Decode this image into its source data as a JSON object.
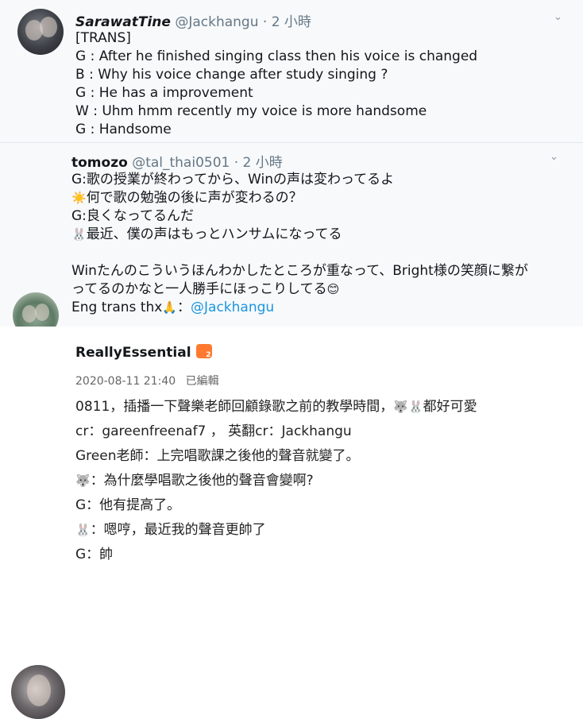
{
  "tweet1": {
    "name": "SarawatTine",
    "handle": "@Jackhangu",
    "time": "· 2 小時",
    "lines": [
      "[TRANS]",
      "G : After he finished singing class then his voice is changed",
      "B : Why his voice change after study singing ?",
      "G : He has a improvement",
      "W : Uhm hmm recently my voice is more handsome",
      "G : Handsome"
    ]
  },
  "tweet2": {
    "name": "tomozo",
    "handle": "@tal_thai0501",
    "time": "· 2 小時",
    "lines": [
      "G:歌の授業が終わってから、Winの声は変わってるよ",
      "何で歌の勉強の後に声が変わるの？",
      "G:良くなってるんだ",
      "最近、僕の声はもっとハンサムになってる",
      "Winたんのこういうほんわかしたところが重なって、Bright様の笑顔に繋が",
      "ってるのかなと一人勝手にほっこりしてる"
    ],
    "credit_prefix": "Eng trans thx",
    "credit_sep": "：",
    "credit_mention": "@Jackhangu"
  },
  "post3": {
    "name": "ReallyEssential",
    "date": "2020-08-11 21:40",
    "edited": "已編輯",
    "line1": "0811，插播一下聲樂老師回顧錄歌之前的教學時間，",
    "line1_tail": "都好可愛",
    "line2": "cr：gareenfreenaf7 ， 英翻cr：Jackhangu",
    "line3": "Green老師：上完唱歌課之後他的聲音就變了。",
    "line4": "：為什麼學唱歌之後他的聲音會變啊?",
    "line5": "G：他有提高了。",
    "line6": "：嗯哼，最近我的聲音更帥了",
    "line7": "G：帥"
  },
  "icons": {
    "sun": "☀️",
    "bunny": "🐰",
    "wolf": "🐺",
    "pray": "🙏",
    "smile": "😊"
  }
}
